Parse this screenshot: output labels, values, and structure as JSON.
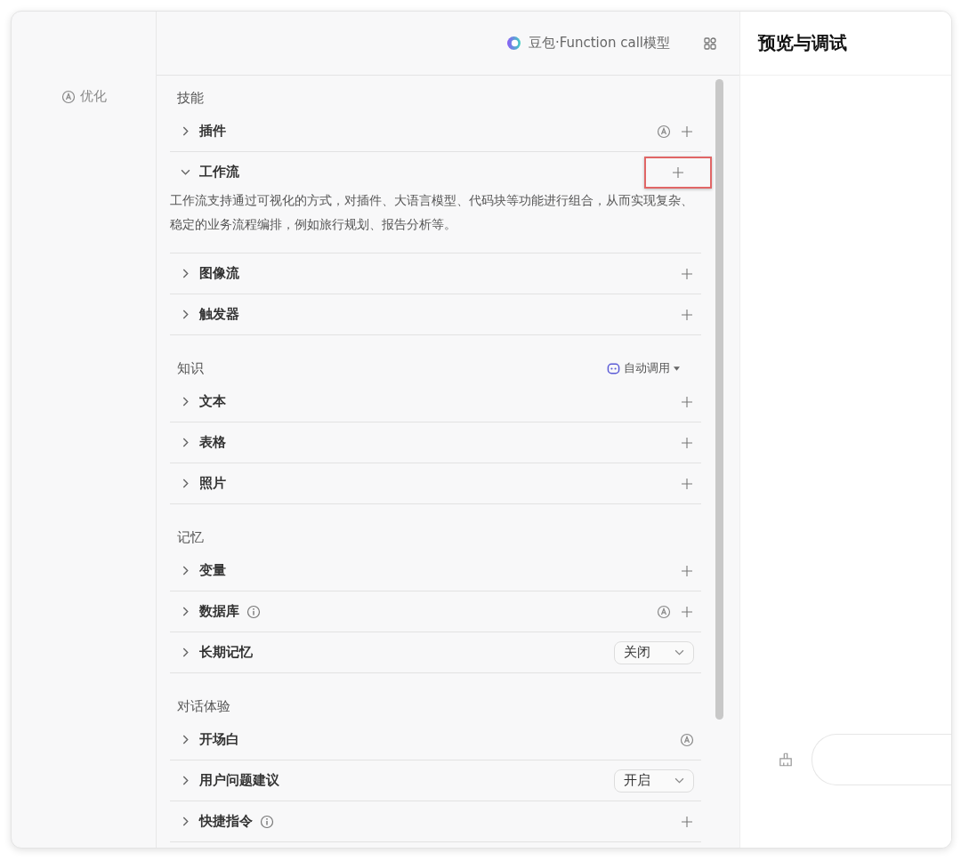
{
  "sidebar": {
    "optimize_label": "优化"
  },
  "model_bar": {
    "model_name": "豆包·Function call模型"
  },
  "sections": [
    {
      "title": "技能",
      "rows": [
        {
          "label": "插件",
          "kind": "auto-add",
          "expanded": false,
          "info": false,
          "highlighted": false
        },
        {
          "label": "工作流",
          "kind": "add",
          "expanded": true,
          "info": false,
          "highlighted": true,
          "description": "工作流支持通过可视化的方式，对插件、大语言模型、代码块等功能进行组合，从而实现复杂、稳定的业务流程编排，例如旅行规划、报告分析等。"
        },
        {
          "label": "图像流",
          "kind": "add",
          "expanded": false,
          "info": false,
          "highlighted": false
        },
        {
          "label": "触发器",
          "kind": "add",
          "expanded": false,
          "info": false,
          "highlighted": false
        }
      ]
    },
    {
      "title": "知识",
      "mode": "自动调用",
      "rows": [
        {
          "label": "文本",
          "kind": "add",
          "expanded": false,
          "info": false,
          "highlighted": false
        },
        {
          "label": "表格",
          "kind": "add",
          "expanded": false,
          "info": false,
          "highlighted": false
        },
        {
          "label": "照片",
          "kind": "add",
          "expanded": false,
          "info": false,
          "highlighted": false
        }
      ]
    },
    {
      "title": "记忆",
      "rows": [
        {
          "label": "变量",
          "kind": "add",
          "expanded": false,
          "info": false,
          "highlighted": false
        },
        {
          "label": "数据库",
          "kind": "auto-add",
          "expanded": false,
          "info": true,
          "highlighted": false
        },
        {
          "label": "长期记忆",
          "kind": "select",
          "value": "关闭",
          "expanded": false,
          "info": false,
          "highlighted": false
        }
      ]
    },
    {
      "title": "对话体验",
      "rows": [
        {
          "label": "开场白",
          "kind": "auto",
          "expanded": false,
          "info": false,
          "highlighted": false
        },
        {
          "label": "用户问题建议",
          "kind": "select",
          "value": "开启",
          "expanded": false,
          "info": false,
          "highlighted": false
        },
        {
          "label": "快捷指令",
          "kind": "add",
          "expanded": false,
          "info": true,
          "highlighted": false
        }
      ]
    }
  ],
  "preview": {
    "title": "预览与调试"
  }
}
